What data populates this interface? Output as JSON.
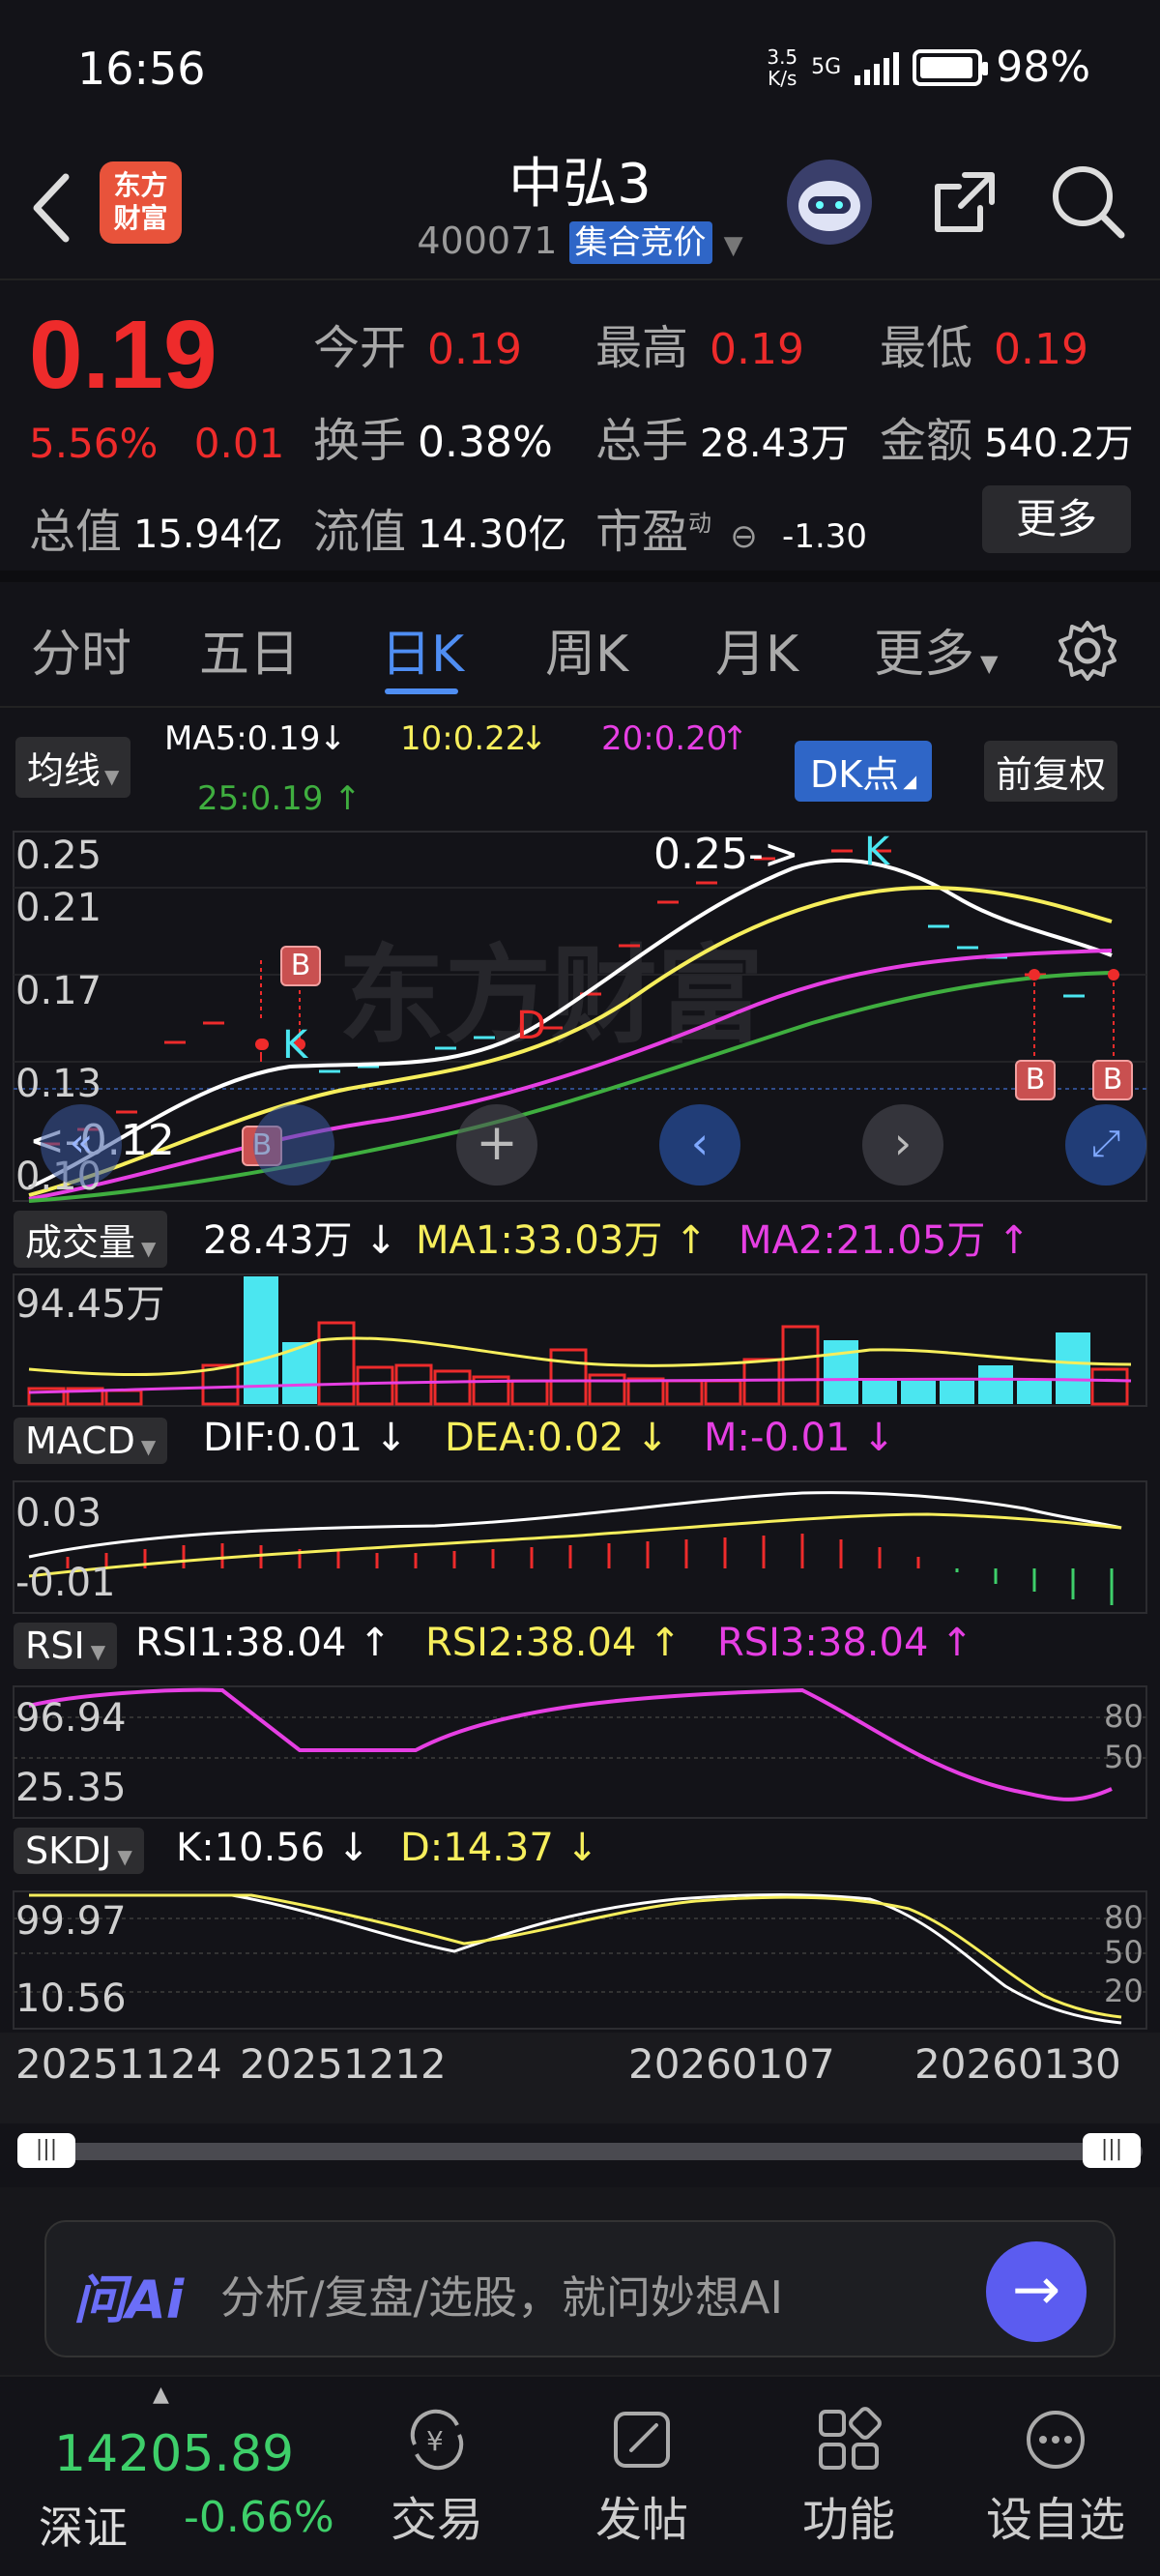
{
  "status": {
    "time": "16:56",
    "net_speed_top": "3.5",
    "net_speed_bottom": "K/s",
    "network": "5G",
    "battery": "98%"
  },
  "header": {
    "title": "中弘3",
    "code": "400071",
    "tag": "集合竞价",
    "logo_text": "东方财富"
  },
  "quote": {
    "price": "0.19",
    "change_pct": "5.56%",
    "change_abs": "0.01",
    "open_label": "今开",
    "open": "0.19",
    "high_label": "最高",
    "high": "0.19",
    "low_label": "最低",
    "low": "0.19",
    "turnover_label": "换手",
    "turnover": "0.38%",
    "volume_label": "总手",
    "volume": "28.43万",
    "amount_label": "金额",
    "amount": "540.2万",
    "mktcap_label": "总值",
    "mktcap": "15.94亿",
    "float_label": "流值",
    "float": "14.30亿",
    "pe_label": "市盈",
    "pe_sup": "动",
    "pe": "-1.30",
    "more": "更多"
  },
  "tabs": [
    "分时",
    "五日",
    "日K",
    "周K",
    "月K",
    "更多"
  ],
  "active_tab": "日K",
  "ma_bar": {
    "btn": "均线",
    "ma5": "MA5:0.19",
    "ma10": "10:0.22",
    "ma20": "20:0.20",
    "ma25": "25:0.19",
    "dk": "DK点",
    "adjust": "前复权"
  },
  "kline": {
    "y_ticks": [
      "0.25",
      "0.21",
      "0.17",
      "0.13",
      "0.10"
    ],
    "high_mark": "0.25->",
    "low_mark": "<-0.12",
    "k_marker": "K",
    "d_marker": "D",
    "b_marker": "B",
    "watermark": "东方财富"
  },
  "volume": {
    "btn": "成交量",
    "val": "28.43万",
    "ma1": "MA1:33.03万",
    "ma2": "MA2:21.05万",
    "y_top": "94.45万"
  },
  "macd": {
    "btn": "MACD",
    "dif": "DIF:0.01",
    "dea": "DEA:0.02",
    "m": "M:-0.01",
    "y_top": "0.03",
    "y_bottom": "-0.01"
  },
  "rsi": {
    "btn": "RSI",
    "rsi1": "RSI1:38.04",
    "rsi2": "RSI2:38.04",
    "rsi3": "RSI3:38.04",
    "y_top": "96.94",
    "y_bottom": "25.35",
    "lvl80": "80",
    "lvl50": "50"
  },
  "skdj": {
    "btn": "SKDJ",
    "k": "K:10.56",
    "d": "D:14.37",
    "y_top": "99.97",
    "y_bottom": "10.56",
    "lvl80": "80",
    "lvl50": "50",
    "lvl20": "20"
  },
  "dates": [
    "20251124",
    "20251212",
    "20260107",
    "20260130"
  ],
  "ask": {
    "ai": "问Ai",
    "placeholder": "分析/复盘/选股，就问妙想AI"
  },
  "bottom": {
    "index_value": "14205.89",
    "index_name": "深证",
    "index_pct": "-0.66%",
    "nav": [
      "交易",
      "发帖",
      "功能",
      "设自选"
    ]
  },
  "colors": {
    "up": "#ee2b2b",
    "down": "#3ecf6a",
    "accent": "#4f8ef3",
    "ma5": "#ffffff",
    "ma10": "#f6ee5c",
    "ma20": "#e63fe3",
    "ma25": "#3fae3f"
  }
}
